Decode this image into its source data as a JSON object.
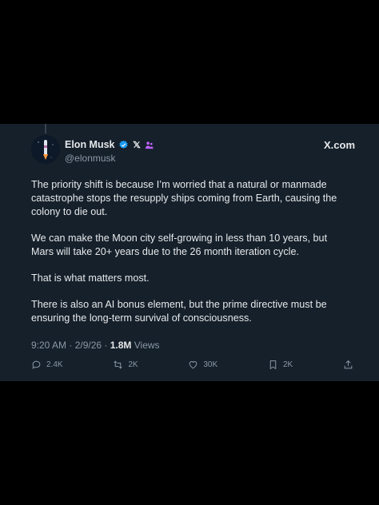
{
  "author": {
    "name": "Elon Musk",
    "handle": "@elonmusk",
    "verified_color": "#1d9bf0",
    "affiliation_badge_icon": "x-logo-icon",
    "extra_badge_icon": "people-icon"
  },
  "brand": {
    "label": "X.com"
  },
  "post": {
    "paragraphs": [
      "The priority shift is because I’m worried that a natural or manmade catastrophe stops the resupply ships coming from Earth, causing the colony to die out.",
      "We can make the Moon city self-growing in less than 10 years, but Mars will take 20+ years due to the 26 month iteration cycle.",
      "That is what matters most.",
      "There is also an AI bonus element, but the prime directive must be ensuring the long-term survival of consciousness."
    ],
    "timestamp": "9:20 AM · 2/9/26 · ",
    "views_count": "1.8M",
    "views_label": " Views"
  },
  "actions": {
    "replies": "2.4K",
    "reposts": "2K",
    "likes": "30K",
    "bookmarks": "2K"
  },
  "colors": {
    "background": "#15202b",
    "text": "#e7e9ea",
    "muted": "#8b98a5",
    "accent": "#1d9bf0",
    "badge_purple": "#c060ff"
  }
}
